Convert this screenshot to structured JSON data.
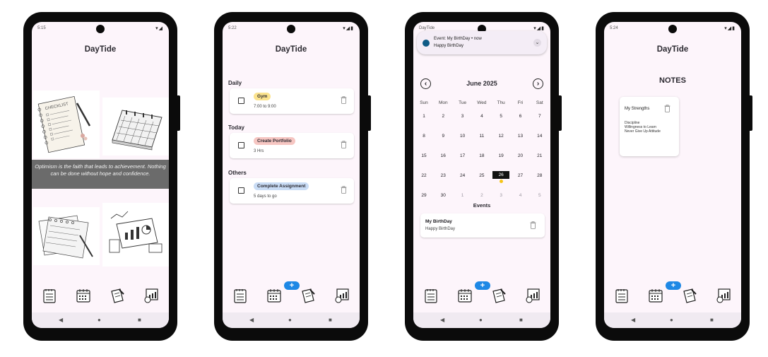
{
  "app_title": "DayTide",
  "nav_glyphs": {
    "back": "◀",
    "home": "●",
    "recents": "■"
  },
  "fab_label": "+",
  "phone1": {
    "time": "5:15",
    "status_icons": "▾◢",
    "quote": "Optimism is the faith that leads to achievement. Nothing can be done without hope and confidence.",
    "checklist_title": "CHECKLIST"
  },
  "phone2": {
    "time": "5:22",
    "status_icons": "▾◢▮",
    "sections": [
      {
        "title": "Daily",
        "task": "Gym",
        "sub": "7:00 to 9:00",
        "chip_color": "#fbe38e"
      },
      {
        "title": "Today",
        "task": "Create Portfolio",
        "sub": "3 Hrs",
        "chip_color": "#f6c6c2"
      },
      {
        "title": "Others",
        "task": "Complete Assignment",
        "sub": "5 days to go",
        "chip_color": "#c9dcf5"
      }
    ]
  },
  "phone3": {
    "status_app": "DayTide",
    "status_icons": "▾◢▮",
    "notification": {
      "title": "Event: My BirthDay • now",
      "body": "Happy BirthDay",
      "expand": "⌄"
    },
    "month": "June 2025",
    "prev": "‹",
    "next": "›",
    "weekdays": [
      "Sun",
      "Mon",
      "Tue",
      "Wed",
      "Thu",
      "Fri",
      "Sat"
    ],
    "days": [
      [
        "1",
        "2",
        "3",
        "4",
        "5",
        "6",
        "7"
      ],
      [
        "8",
        "9",
        "10",
        "11",
        "12",
        "13",
        "14"
      ],
      [
        "15",
        "16",
        "17",
        "18",
        "19",
        "20",
        "21"
      ],
      [
        "22",
        "23",
        "24",
        "25",
        "26",
        "27",
        "28"
      ],
      [
        "29",
        "30",
        "1",
        "2",
        "3",
        "4",
        "5"
      ]
    ],
    "selected_day": "26",
    "events_title": "Events",
    "event": {
      "title": "My BirthDay",
      "sub": "Happy BirthDay"
    }
  },
  "phone4": {
    "time": "5:24",
    "status_icons": "▾◢▮",
    "heading": "NOTES",
    "note": {
      "title": "My Strengths",
      "body": "Discipline\nWillingness to Learn\nNever Give Up Attitude"
    }
  }
}
